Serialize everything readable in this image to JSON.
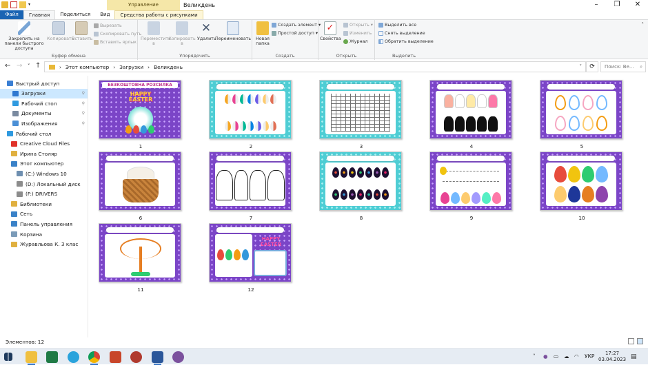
{
  "window": {
    "title": "Великдень",
    "context_tab": "Управление"
  },
  "ribbon_tabs": [
    {
      "label": "Файл"
    },
    {
      "label": "Главная"
    },
    {
      "label": "Поделиться"
    },
    {
      "label": "Вид"
    },
    {
      "label": "Средства работы с рисунками"
    }
  ],
  "ribbon": {
    "clipboard": {
      "label": "Буфер обмена",
      "pin": "Закрепить на панели быстрого доступа",
      "copy": "Копировать",
      "paste": "Вставить",
      "cut": "Вырезать",
      "copy_path": "Скопировать путь",
      "paste_shortcut": "Вставить ярлык"
    },
    "organize": {
      "label": "Упорядочить",
      "move": "Переместить в",
      "copy_to": "Копировать в",
      "delete": "Удалить",
      "rename": "Переименовать"
    },
    "create": {
      "label": "Создать",
      "new_folder": "Новая папка",
      "new_item": "Создать элемент",
      "easy_access": "Простой доступ"
    },
    "open": {
      "label": "Открыть",
      "properties": "Свойства",
      "open": "Открыть",
      "edit": "Изменить",
      "history": "Журнал"
    },
    "select": {
      "label": "Выделить",
      "select_all": "Выделить все",
      "select_none": "Снять выделение",
      "invert": "Обратить выделение"
    }
  },
  "address": {
    "crumbs": [
      "Этот компьютер",
      "Загрузки",
      "Великдень"
    ],
    "search_placeholder": "Поиск: Ве..."
  },
  "nav": [
    {
      "label": "Быстрый доступ",
      "color": "#3a7fd4"
    },
    {
      "label": "Загрузки",
      "color": "#2f78d0",
      "selected": true,
      "pinned": true
    },
    {
      "label": "Рабочий стол",
      "color": "#2f9ae0",
      "pinned": true
    },
    {
      "label": "Документы",
      "color": "#7a8aa0",
      "pinned": true
    },
    {
      "label": "Изображения",
      "color": "#4a8fd6",
      "pinned": true
    },
    {
      "label": "Рабочий стол",
      "color": "#2f9ae0"
    },
    {
      "label": "Creative Cloud Files",
      "color": "#e0322a"
    },
    {
      "label": "Ирина Столяр",
      "color": "#e0b040"
    },
    {
      "label": "Этот компьютер",
      "color": "#3a82c8"
    },
    {
      "label": "(C:) Windows 10",
      "color": "#6e8fb0"
    },
    {
      "label": "(D:) Локальный диск",
      "color": "#8c8c8c"
    },
    {
      "label": "(F:) DRIVERS",
      "color": "#8c8c8c"
    },
    {
      "label": "Библиотеки",
      "color": "#e0b040"
    },
    {
      "label": "Сеть",
      "color": "#3a82c8"
    },
    {
      "label": "Панель управления",
      "color": "#3a82c8"
    },
    {
      "label": "Корзина",
      "color": "#7b9bb8"
    },
    {
      "label": "Журавльова К. 3 клас",
      "color": "#e0b040"
    }
  ],
  "files": [
    {
      "label": "1",
      "cover_title": "БЕЗКОШТОВНА РОЗСИЛКА",
      "cover_text": "HAPPY EASTER"
    },
    {
      "label": "2"
    },
    {
      "label": "3"
    },
    {
      "label": "4"
    },
    {
      "label": "5"
    },
    {
      "label": "6"
    },
    {
      "label": "7"
    },
    {
      "label": "8"
    },
    {
      "label": "9"
    },
    {
      "label": "10"
    },
    {
      "label": "11"
    },
    {
      "label": "12",
      "cover_text": "HAPPY EASTER"
    }
  ],
  "status": {
    "items": "Элементов: 12"
  },
  "taskbar": {
    "time": "17:27",
    "date": "03.04.2023",
    "lang": "УКР"
  }
}
